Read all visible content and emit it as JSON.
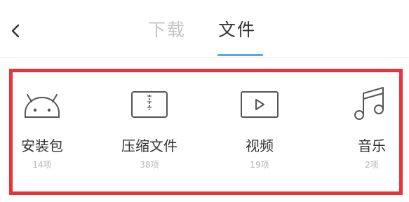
{
  "header": {
    "back_icon": "chevron-left-icon",
    "tabs": [
      {
        "label": "下载",
        "active": false
      },
      {
        "label": "文件",
        "active": true
      }
    ],
    "indicator_color": "#5aa7e6"
  },
  "highlight_color": "#e8333b",
  "categories": [
    {
      "label": "安装包",
      "count": "14项",
      "icon": "android-icon"
    },
    {
      "label": "压缩文件",
      "count": "38项",
      "icon": "archive-icon"
    },
    {
      "label": "视频",
      "count": "19项",
      "icon": "video-play-icon"
    },
    {
      "label": "音乐",
      "count": "2项",
      "icon": "music-note-icon"
    }
  ]
}
